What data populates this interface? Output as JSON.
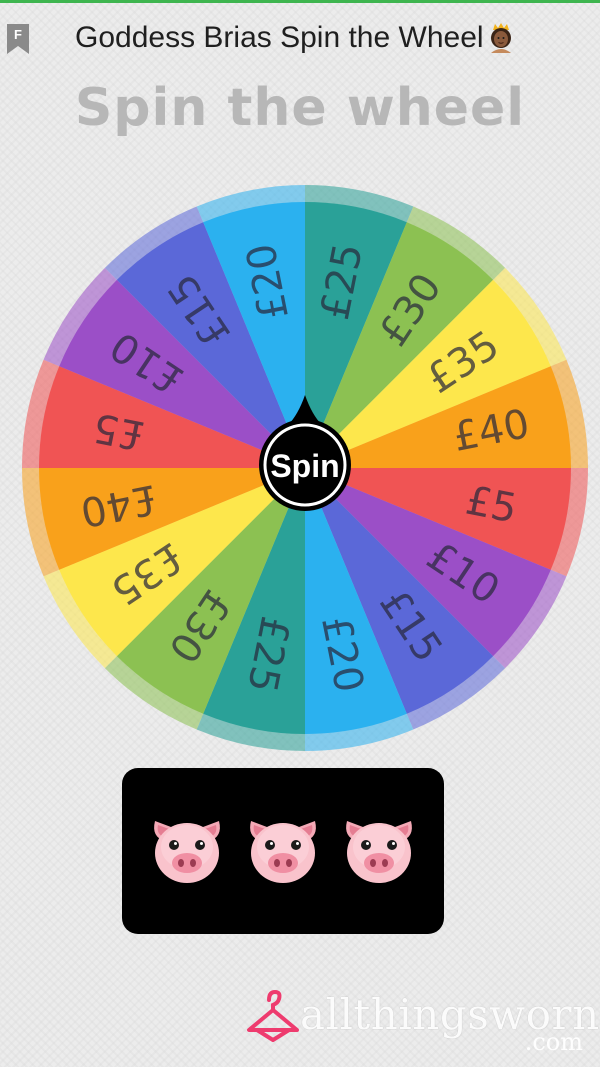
{
  "header": {
    "title": "Goddess Brias Spin the Wheel",
    "bookmark_icon": "bookmark-f-icon",
    "title_emoji_icon": "crown-woman-icon"
  },
  "page_title": "Spin the wheel",
  "wheel": {
    "segments": [
      {
        "label": "£25",
        "color": "#2aa198"
      },
      {
        "label": "£30",
        "color": "#8cc152"
      },
      {
        "label": "£35",
        "color": "#fde74c"
      },
      {
        "label": "£40",
        "color": "#f9a11b"
      },
      {
        "label": "£5",
        "color": "#f05454"
      },
      {
        "label": "£10",
        "color": "#9b4fc7"
      },
      {
        "label": "£15",
        "color": "#5b68d8"
      },
      {
        "label": "£20",
        "color": "#2bb1ef"
      },
      {
        "label": "£25",
        "color": "#2aa198"
      },
      {
        "label": "£30",
        "color": "#8cc152"
      },
      {
        "label": "£35",
        "color": "#fde74c"
      },
      {
        "label": "£40",
        "color": "#f9a11b"
      },
      {
        "label": "£5",
        "color": "#f05454"
      },
      {
        "label": "£10",
        "color": "#9b4fc7"
      },
      {
        "label": "£15",
        "color": "#5b68d8"
      },
      {
        "label": "£20",
        "color": "#2bb1ef"
      }
    ],
    "spin_label": "Spin"
  },
  "reel": {
    "icons": [
      "pig-face-icon",
      "pig-face-icon",
      "pig-face-icon"
    ]
  },
  "watermark": {
    "text": "allthingsworn",
    "suffix": ".com",
    "icon": "hanger-icon"
  }
}
